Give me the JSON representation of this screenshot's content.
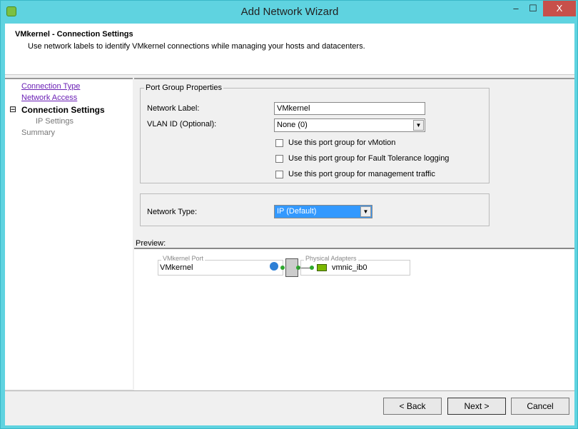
{
  "window": {
    "title": "Add Network Wizard",
    "minimize": "–",
    "maximize": "☐",
    "close": "X"
  },
  "header": {
    "title": "VMkernel - Connection Settings",
    "subtitle": "Use network labels to identify VMkernel connections while managing your hosts and datacenters."
  },
  "steps": [
    {
      "label": "Connection Type"
    },
    {
      "label": "Network Access"
    },
    {
      "label": "Connection Settings",
      "expander": "⊟"
    },
    {
      "label": "IP Settings"
    },
    {
      "label": "Summary"
    }
  ],
  "port_group": {
    "legend": "Port Group Properties",
    "network_label_label": "Network Label:",
    "network_label_value": "VMkernel",
    "vlan_label": "VLAN ID (Optional):",
    "vlan_value": "None (0)",
    "checks": [
      {
        "label": "Use this port group for vMotion",
        "checked": false
      },
      {
        "label": "Use this port group for Fault Tolerance logging",
        "checked": false
      },
      {
        "label": "Use this port group for management traffic",
        "checked": false
      }
    ]
  },
  "network_type": {
    "label": "Network Type:",
    "value": "IP (Default)"
  },
  "preview": {
    "label": "Preview:",
    "port_legend": "VMkernel Port",
    "port_name": "VMkernel",
    "adapters_legend": "Physical Adapters",
    "adapter": "vmnic_ib0"
  },
  "buttons": {
    "back": "< Back",
    "next": "Next >",
    "cancel": "Cancel"
  }
}
